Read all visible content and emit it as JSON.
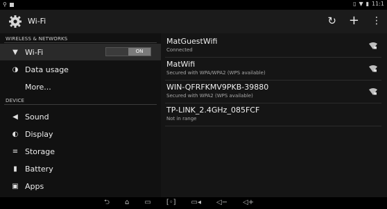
{
  "status_bar": {
    "time": "11:1"
  },
  "action_bar": {
    "title": "Wi-Fi",
    "icons": [
      "wps-refresh-icon",
      "add-network-icon",
      "overflow-menu-icon"
    ]
  },
  "sidebar": {
    "sections": [
      {
        "header": "WIRELESS & NETWORKS"
      },
      {
        "header": "DEVICE"
      }
    ],
    "items": [
      {
        "label": "Wi-Fi",
        "icon": "wifi-icon",
        "toggle": "ON",
        "selected": true
      },
      {
        "label": "Data usage",
        "icon": "data-usage-icon"
      },
      {
        "label": "More..."
      },
      {
        "label": "Sound",
        "icon": "sound-icon"
      },
      {
        "label": "Display",
        "icon": "display-icon"
      },
      {
        "label": "Storage",
        "icon": "storage-icon"
      },
      {
        "label": "Battery",
        "icon": "battery-icon"
      },
      {
        "label": "Apps",
        "icon": "apps-icon"
      }
    ]
  },
  "networks": [
    {
      "name": "MatGuestWifi",
      "status": "Connected",
      "signal": true
    },
    {
      "name": "MatWifi",
      "status": "Secured with WPA/WPA2 (WPS available)",
      "signal": true
    },
    {
      "name": "WIN-QFRFKMV9PKB-39880",
      "status": "Secured with WPA2 (WPS available)",
      "signal": true
    },
    {
      "name": "TP-LINK_2.4GHz_085FCF",
      "status": "Not in range",
      "signal": false
    }
  ],
  "navigation_bar": {
    "buttons": [
      "back-icon",
      "home-icon",
      "recent-apps-icon",
      "screenshot-icon",
      "camera-icon",
      "volume-down-icon",
      "volume-up-icon"
    ]
  }
}
